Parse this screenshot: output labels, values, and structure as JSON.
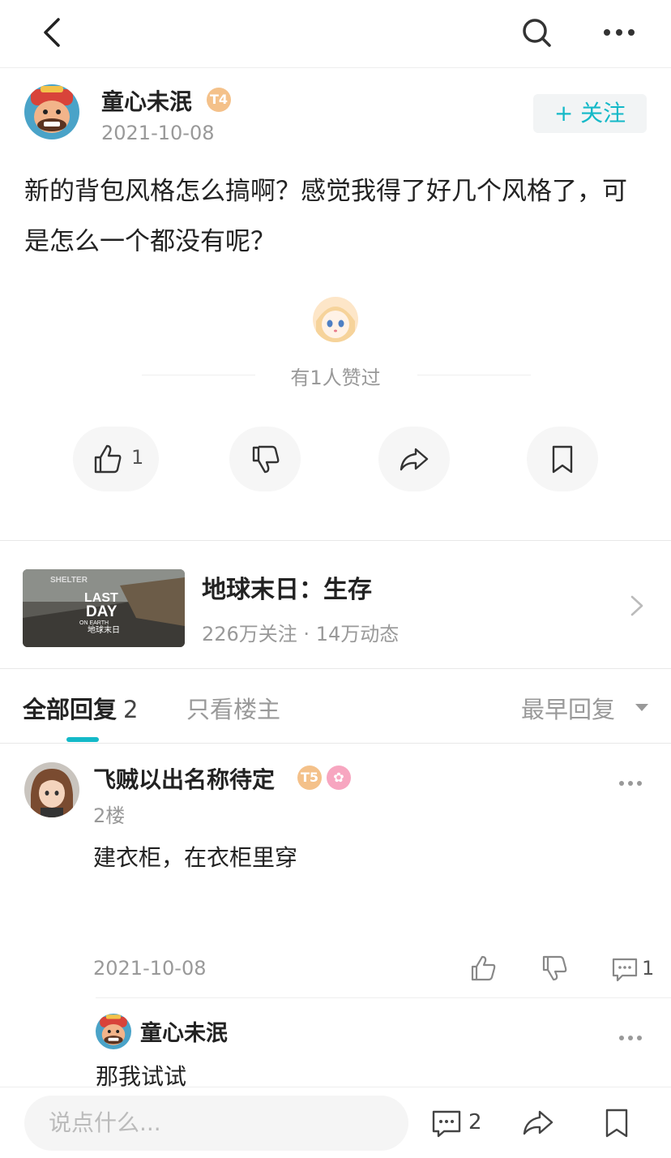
{
  "header": {
    "back_icon": "back-arrow-icon",
    "search_icon": "search-icon",
    "more_icon": "more-dots-icon"
  },
  "post": {
    "author_name": "童心未泯",
    "author_badge": "T4",
    "date": "2021-10-08",
    "follow_label": "+ 关注",
    "body": "新的背包风格怎么搞啊？感觉我得了好几个风格了，可是怎么一个都没有呢？",
    "likers_text": "有1人赞过",
    "like_count": "1"
  },
  "game": {
    "title": "地球末日：生存",
    "stats": "226万关注 · 14万动态",
    "thumb_text_shelter": "SHELTER",
    "thumb_text_logo_line1": "LAST",
    "thumb_text_logo_line2": "DAY",
    "thumb_text_logo_line3": "ON EARTH",
    "thumb_text_cn": "地球末日"
  },
  "tabs": {
    "all_label": "全部回复",
    "all_count": "2",
    "owner_label": "只看楼主",
    "sort_label": "最早回复"
  },
  "reply": {
    "name": "飞贼以出名称待定",
    "badge": "T5",
    "floor": "2楼",
    "body": "建衣柜，在衣柜里穿",
    "date": "2021-10-08",
    "comment_count": "1",
    "sub_reply": {
      "name": "童心未泯",
      "body": "那我试试"
    }
  },
  "bottom": {
    "input_placeholder": "说点什么...",
    "comment_count": "2"
  },
  "colors": {
    "accent": "#14b9c8",
    "muted": "#999999"
  }
}
